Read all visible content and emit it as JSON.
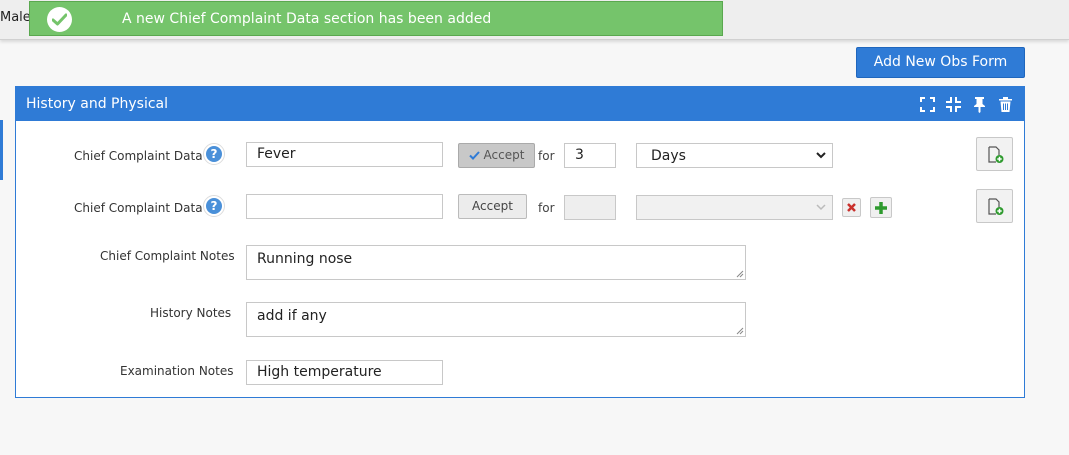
{
  "patient": {
    "gender": "Male"
  },
  "toast": {
    "message": "A new Chief Complaint Data section has been added"
  },
  "toolbar": {
    "add_obs_form_label": "Add New Obs Form"
  },
  "panel": {
    "title": "History and Physical"
  },
  "complaints": [
    {
      "label": "Chief Complaint Data",
      "value": "Fever",
      "accept_label": "Accept",
      "accepted": true,
      "for_label": "for",
      "duration": "3",
      "unit": "Days"
    },
    {
      "label": "Chief Complaint Data",
      "value": "",
      "accept_label": "Accept",
      "accepted": false,
      "for_label": "for",
      "duration": "",
      "unit": ""
    }
  ],
  "notes": {
    "chief_complaint": {
      "label": "Chief Complaint Notes",
      "value": "Running nose"
    },
    "history": {
      "label": "History Notes",
      "value": "add if any"
    },
    "examination": {
      "label": "Examination Notes",
      "value": "High temperature"
    }
  },
  "colors": {
    "primary": "#2f7bd6",
    "success": "#75c46b",
    "remove": "#c9302c",
    "add": "#2e9a2e"
  }
}
